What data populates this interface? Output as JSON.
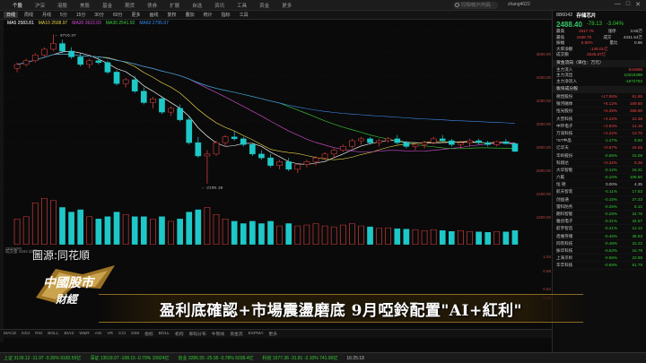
{
  "topbar": {
    "menu": [
      "个股",
      "沪深",
      "港股",
      "美股",
      "基金",
      "期货",
      "债券",
      "扩展",
      "自选",
      "资讯",
      "工具",
      "资金",
      "更多"
    ],
    "search_placeholder": "行情/帐户/代码",
    "user": "zhang4022",
    "window_buttons": [
      "—",
      "□",
      "✕"
    ]
  },
  "toolbar": {
    "periods": [
      "日线",
      "周线",
      "月线",
      "5分",
      "15分",
      "30分",
      "60分",
      "更多"
    ],
    "selected": "日线",
    "tools": [
      "画线",
      "复权",
      "叠加",
      "统计",
      "指标",
      "工具"
    ]
  },
  "ma_line": [
    {
      "text": "MA5 2583.81",
      "color": "#ffffff"
    },
    {
      "text": "MA10 2508.97",
      "color": "#e8d34a"
    },
    {
      "text": "MA20 2622.03",
      "color": "#d64fd6"
    },
    {
      "text": "MA30 2541.92",
      "color": "#3fd23f"
    },
    {
      "text": "MA60 2795.97",
      "color": "#3a8df0"
    }
  ],
  "y_axis": {
    "labels": [
      "3600.00",
      "3400.00",
      "3200.00",
      "3000.00",
      "2800.00",
      "2600.00",
      "2400.00",
      "2200.00",
      "1.04",
      "0.69",
      "0.52",
      "0.26"
    ]
  },
  "chart_data": {
    "type": "candlestick",
    "annotations": {
      "high": "3716.37",
      "low": "2150.18"
    },
    "x_start_label": "2024/06",
    "candles": [
      [
        3360,
        3420,
        3320,
        3400
      ],
      [
        3400,
        3460,
        3380,
        3440
      ],
      [
        3440,
        3520,
        3420,
        3500
      ],
      [
        3500,
        3580,
        3480,
        3560
      ],
      [
        3560,
        3716,
        3540,
        3620
      ],
      [
        3620,
        3660,
        3520,
        3540
      ],
      [
        3540,
        3580,
        3460,
        3480
      ],
      [
        3480,
        3520,
        3380,
        3400
      ],
      [
        3400,
        3460,
        3360,
        3440
      ],
      [
        3440,
        3480,
        3400,
        3420
      ],
      [
        3420,
        3440,
        3300,
        3320
      ],
      [
        3320,
        3340,
        3180,
        3200
      ],
      [
        3200,
        3260,
        3160,
        3240
      ],
      [
        3240,
        3280,
        3100,
        3120
      ],
      [
        3120,
        3160,
        2980,
        3000
      ],
      [
        3000,
        3060,
        2940,
        3040
      ],
      [
        3040,
        3060,
        2880,
        2900
      ],
      [
        2900,
        2960,
        2860,
        2940
      ],
      [
        2940,
        2980,
        2800,
        2820
      ],
      [
        2820,
        2860,
        2560,
        2580
      ],
      [
        2580,
        2640,
        2420,
        2440
      ],
      [
        2440,
        2500,
        2150,
        2460
      ],
      [
        2460,
        2600,
        2440,
        2580
      ],
      [
        2580,
        2660,
        2540,
        2640
      ],
      [
        2640,
        2700,
        2600,
        2620
      ],
      [
        2620,
        2640,
        2540,
        2560
      ],
      [
        2560,
        2580,
        2440,
        2460
      ],
      [
        2460,
        2500,
        2400,
        2420
      ],
      [
        2420,
        2460,
        2320,
        2340
      ],
      [
        2340,
        2400,
        2300,
        2380
      ],
      [
        2380,
        2420,
        2280,
        2300
      ],
      [
        2300,
        2360,
        2260,
        2350
      ],
      [
        2350,
        2400,
        2320,
        2380
      ],
      [
        2380,
        2440,
        2340,
        2420
      ],
      [
        2420,
        2480,
        2400,
        2460
      ],
      [
        2460,
        2520,
        2420,
        2500
      ],
      [
        2500,
        2560,
        2480,
        2540
      ],
      [
        2540,
        2620,
        2520,
        2600
      ],
      [
        2600,
        2640,
        2560,
        2620
      ],
      [
        2620,
        2640,
        2560,
        2580
      ],
      [
        2580,
        2620,
        2540,
        2600
      ],
      [
        2600,
        2640,
        2580,
        2620
      ],
      [
        2620,
        2660,
        2560,
        2580
      ],
      [
        2580,
        2600,
        2520,
        2540
      ],
      [
        2540,
        2580,
        2500,
        2560
      ],
      [
        2560,
        2600,
        2520,
        2580
      ],
      [
        2580,
        2640,
        2560,
        2620
      ],
      [
        2620,
        2660,
        2580,
        2600
      ],
      [
        2600,
        2620,
        2540,
        2560
      ],
      [
        2560,
        2600,
        2520,
        2580
      ],
      [
        2580,
        2620,
        2540,
        2600
      ],
      [
        2600,
        2620,
        2560,
        2580
      ],
      [
        2580,
        2600,
        2540,
        2560
      ],
      [
        2560,
        2600,
        2540,
        2590
      ],
      [
        2590,
        2620,
        2560,
        2570
      ],
      [
        2570,
        2580,
        2480,
        2488
      ]
    ],
    "volumes": [
      0.55,
      0.6,
      0.9,
      1.0,
      0.95,
      0.8,
      0.7,
      0.75,
      0.6,
      0.55,
      0.6,
      0.7,
      0.65,
      0.6,
      0.6,
      0.55,
      0.6,
      0.5,
      0.55,
      0.7,
      0.75,
      0.8,
      0.65,
      0.55,
      0.5,
      0.45,
      0.5,
      0.45,
      0.5,
      0.4,
      0.45,
      0.4,
      0.42,
      0.45,
      0.4,
      0.38,
      0.42,
      0.45,
      0.4,
      0.38,
      0.35,
      0.36,
      0.34,
      0.33,
      0.32,
      0.3,
      0.32,
      0.3,
      0.28,
      0.3,
      0.28,
      0.27,
      0.26,
      0.28,
      0.27,
      0.3
    ]
  },
  "vol_label": "成交量 4344.33万",
  "bottom_tabs": [
    "MACD",
    "KDJ",
    "RSI",
    "BOLL",
    "BIAS",
    "W&R",
    "ASI",
    "VR",
    "CCI",
    "DMI",
    "指标",
    "BOLL",
    "机构",
    "筹码分布",
    "牛熊线",
    "资金流",
    "EXPMA",
    "更多"
  ],
  "statusbar": [
    {
      "text": "上证 3139.12 -11.97 -0.30% 9182.55亿",
      "color": "#3c3"
    },
    {
      "text": "深证 13518.97 -108.15 -0.79% 10924亿",
      "color": "#3c3"
    },
    {
      "text": "创业 3286.55 -25.95 -0.78% 5038.4亿",
      "color": "#3c3"
    },
    {
      "text": "科创 1577.36 -31.81 -2.10% 741.90亿",
      "color": "#3c3"
    },
    {
      "text": "16:25:18",
      "color": "#bbb"
    }
  ],
  "right_panel": {
    "code": "886042",
    "name": "存储芯片",
    "price": "2488.40",
    "change": "-78.13",
    "change_pct": "-3.04%",
    "stats": [
      [
        "最高",
        "2617.78",
        "涨停",
        "3.58万"
      ],
      [
        "最低",
        "2468.79",
        "成交",
        "4341.54万"
      ],
      [
        "振幅",
        "5.80%",
        "量比",
        "0.96"
      ],
      [
        "大单净额",
        "-149.01亿",
        "",
        ""
      ],
      [
        "成交额",
        "2526.87亿",
        "",
        ""
      ]
    ],
    "section1": "资金流向（单位：万元）",
    "flows": [
      [
        "主力流入",
        "644659",
        "#e44"
      ],
      [
        "主力流出",
        "10319399",
        "#3c3"
      ],
      [
        "主力净流入",
        "-1872784",
        "#3c3"
      ]
    ],
    "section2": "板块成分股",
    "stocks": [
      {
        "name": "德昆股份",
        "pct": "+17.56%",
        "price": "61.86"
      },
      {
        "name": "银河磁体",
        "pct": "+8.12%",
        "price": "159.60"
      },
      {
        "name": "恒光股份",
        "pct": "+5.39%",
        "price": "268.50"
      },
      {
        "name": "大普科技",
        "pct": "+4.22%",
        "price": "12.36"
      },
      {
        "name": "中环电子",
        "pct": "+2.83%",
        "price": "14.16"
      },
      {
        "name": "万润科技",
        "pct": "+2.22%",
        "price": "13.70"
      },
      {
        "name": "*ST中晶",
        "pct": "-1.47%",
        "price": "9.84"
      },
      {
        "name": "亿华天",
        "pct": "+0.87%",
        "price": "16.55"
      },
      {
        "name": "华岭股份",
        "pct": "-0.55%",
        "price": "15.09"
      },
      {
        "name": "科翔达",
        "pct": "+0.32%",
        "price": "9.35"
      },
      {
        "name": "大华智能",
        "pct": "-0.12%",
        "price": "16.31"
      },
      {
        "name": "六氟",
        "pct": "-0.10%",
        "price": "106.50"
      },
      {
        "name": "恒 德",
        "pct": "0.00%",
        "price": "4.35"
      },
      {
        "name": "航天智装",
        "pct": "-0.11%",
        "price": "17.53"
      },
      {
        "name": "创益通",
        "pct": "-0.15%",
        "price": "27.33"
      },
      {
        "name": "雷科防务",
        "pct": "-0.25%",
        "price": "8.12"
      },
      {
        "name": "朗科智能",
        "pct": "-0.28%",
        "price": "24.76"
      },
      {
        "name": "雅创电子",
        "pct": "-0.31%",
        "price": "34.87"
      },
      {
        "name": "航宇智造",
        "pct": "-0.41%",
        "price": "12.12"
      },
      {
        "name": "佰维存储",
        "pct": "-0.46%",
        "price": "38.63"
      },
      {
        "name": "同有科技",
        "pct": "-0.48%",
        "price": "22.22"
      },
      {
        "name": "振华科技",
        "pct": "-0.52%",
        "price": "15.78"
      },
      {
        "name": "上海贝岭",
        "pct": "-0.66%",
        "price": "22.88"
      },
      {
        "name": "华丰科技",
        "pct": "-0.68%",
        "price": "61.79"
      }
    ]
  },
  "overlay": {
    "source": "圖源:同花順",
    "logo_text": "中國股市 財經",
    "headline": "盈利底確認+市場震盪磨底 9月啞鈴配置\"AI+紅利\""
  }
}
